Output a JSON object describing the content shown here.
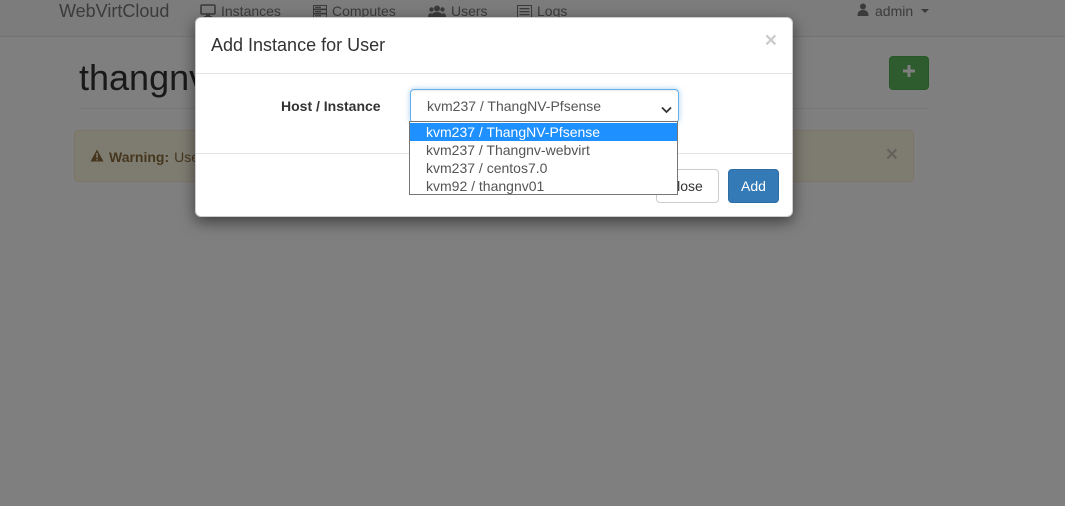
{
  "navbar": {
    "brand": "WebVirtCloud",
    "items": [
      {
        "label": "Instances",
        "icon": "desktop-icon"
      },
      {
        "label": "Computes",
        "icon": "server-icon"
      },
      {
        "label": "Users",
        "icon": "users-icon"
      },
      {
        "label": "Logs",
        "icon": "list-icon"
      }
    ],
    "user": {
      "label": "admin",
      "icon": "user-icon"
    }
  },
  "page": {
    "title": "thangnv",
    "add_button_icon": "plus-icon",
    "alert": {
      "icon": "warning-icon",
      "strong": "Warning:",
      "text": "Use"
    }
  },
  "modal": {
    "title": "Add Instance for User",
    "close_icon": "×",
    "field_label": "Host / Instance",
    "select_value": "kvm237 / ThangNV-Pfsense",
    "options": [
      "kvm237 / ThangNV-Pfsense",
      "kvm237 / Thangnv-webvirt",
      "kvm237 / centos7.0",
      "kvm92 / thangnv01"
    ],
    "selected_index": 0,
    "buttons": {
      "close": "Close",
      "add": "Add"
    }
  },
  "colors": {
    "primary": "#337ab7",
    "success": "#5cb85c",
    "option_highlight": "#1e90ff",
    "warning_bg": "#fcf8e3",
    "warning_text": "#8a6d3b"
  }
}
